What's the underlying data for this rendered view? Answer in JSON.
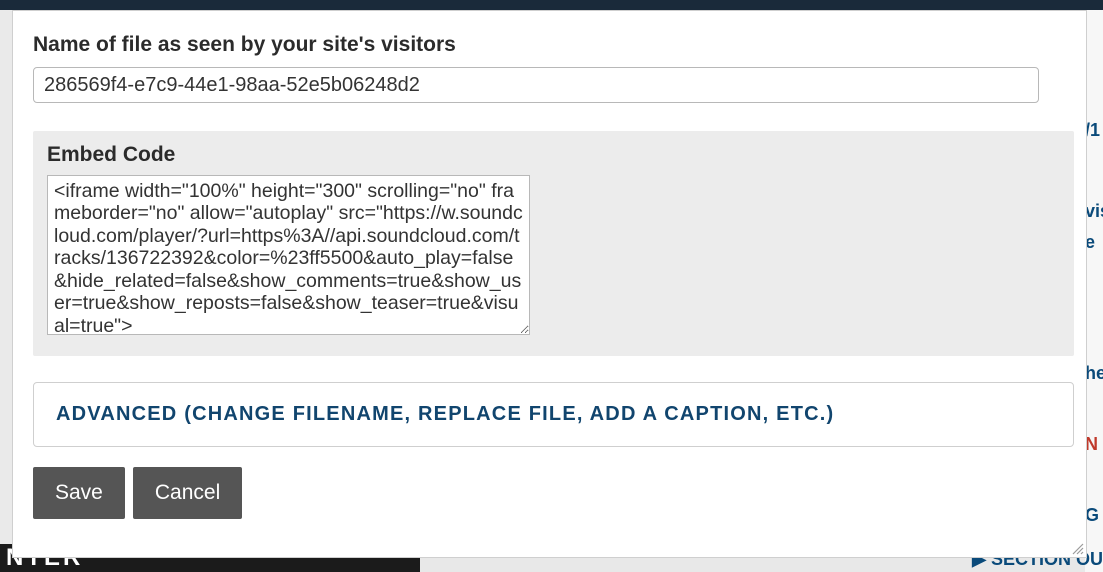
{
  "bg": {
    "bottom_dark_text": "NTER",
    "right_frag_1": "/1",
    "right_frag_2": "vis",
    "right_frag_3": "e",
    "right_frag_4": "he",
    "right_frag_5": "N",
    "right_frag_6": "G",
    "bottom_section_text": "▶  SECTION OU"
  },
  "modal": {
    "filename_label": "Name of file as seen by your site's visitors",
    "filename_value": "286569f4-e7c9-44e1-98aa-52e5b06248d2",
    "embed_label": "Embed Code",
    "embed_value": "<iframe width=\"100%\" height=\"300\" scrolling=\"no\" frameborder=\"no\" allow=\"autoplay\" src=\"https://w.soundcloud.com/player/?url=https%3A//api.soundcloud.com/tracks/136722392&color=%23ff5500&auto_play=false&hide_related=false&show_comments=true&show_user=true&show_reposts=false&show_teaser=true&visual=true\">",
    "advanced_label": "ADVANCED (CHANGE FILENAME, REPLACE FILE, ADD A CAPTION, ETC.)",
    "save_label": "Save",
    "cancel_label": "Cancel"
  }
}
